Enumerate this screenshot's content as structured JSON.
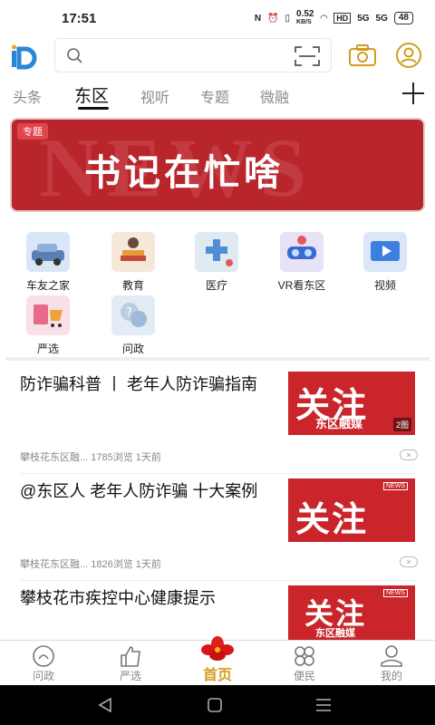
{
  "status": {
    "time": "17:51",
    "nfc": "N",
    "speed_value": "0.52",
    "speed_unit": "KB/S",
    "hd": "HD",
    "sig1": "5G",
    "sig2": "5G",
    "battery": "48"
  },
  "search": {
    "placeholder": ""
  },
  "icons": {
    "logo": "app-logo",
    "search": "search-icon",
    "scan": "scan-icon",
    "camera": "camera-icon",
    "user": "user-icon",
    "add": "add-icon"
  },
  "tabs": [
    "头条",
    "东区",
    "视听",
    "专题",
    "微融"
  ],
  "active_tab": "东区",
  "banner": {
    "tag": "专题",
    "bg_text": "NEWS",
    "title": "书记在忙啥"
  },
  "grid": [
    {
      "label": "车友之家",
      "icon": "car-icon",
      "color": "#d9e6f5"
    },
    {
      "label": "教育",
      "icon": "education-icon",
      "color": "#f5e8d8"
    },
    {
      "label": "医疗",
      "icon": "medical-icon",
      "color": "#dfeaf3"
    },
    {
      "label": "VR看东区",
      "icon": "vr-icon",
      "color": "#e7e2f5"
    },
    {
      "label": "视频",
      "icon": "video-icon",
      "color": "#dbe6f8"
    },
    {
      "label": "严选",
      "icon": "shopping-icon",
      "color": "#f8e0e6"
    },
    {
      "label": "问政",
      "icon": "question-icon",
      "color": "#e3ecf4"
    }
  ],
  "news": [
    {
      "title": "防诈骗科普 丨 老年人防诈骗指南",
      "meta": "攀枝花东区融...   1785浏览  1天前",
      "thumb_title": "关注",
      "thumb_sub": "东区融媒",
      "thumb_count": "2图",
      "close": "×"
    },
    {
      "title": "@东区人 老年人防诈骗 十大案例",
      "meta": "攀枝花东区融...   1826浏览  1天前",
      "thumb_title": "关注",
      "thumb_sub": "",
      "thumb_tag": "NEWS",
      "close": "×"
    },
    {
      "title": "攀枝花市疾控中心健康提示",
      "meta": "",
      "thumb_title": "关注",
      "thumb_sub": "东区融媒",
      "thumb_tag": "NEWS"
    }
  ],
  "bottom_nav": [
    {
      "label": "问政",
      "icon": "question-icon"
    },
    {
      "label": "严选",
      "icon": "thumb-up-icon"
    },
    {
      "label": "首页",
      "icon": "flower-icon",
      "active": true
    },
    {
      "label": "便民",
      "icon": "grid-icon"
    },
    {
      "label": "我的",
      "icon": "profile-icon"
    }
  ],
  "colors": {
    "accent": "#d39c1f",
    "red": "#c9252b"
  }
}
